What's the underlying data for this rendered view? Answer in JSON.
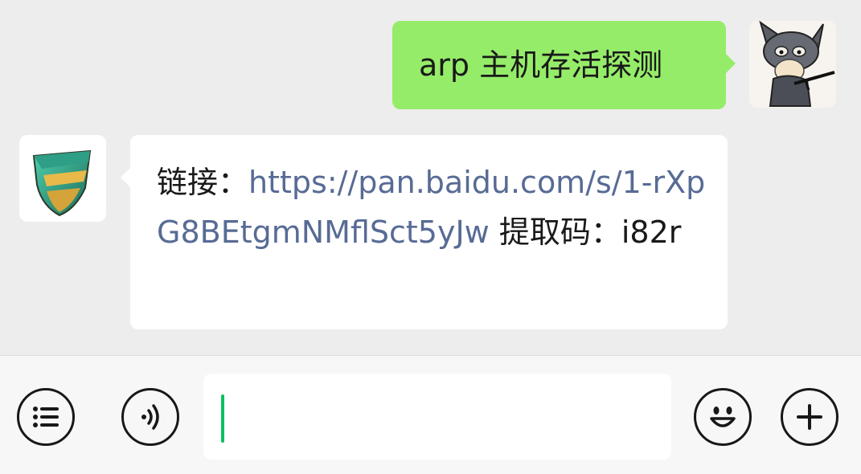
{
  "chat": {
    "messages": [
      {
        "direction": "outgoing",
        "avatar_icon": "cat-hood-avatar-icon",
        "text": "arp 主机存活探测"
      },
      {
        "direction": "incoming",
        "avatar_icon": "shield-logo-icon",
        "prefix": "链接：",
        "link": "https://pan.baidu.com/s/1-rXpG8BEtgmNMflSct5yJw",
        "suffix": " 提取码：i82r"
      }
    ]
  },
  "input_bar": {
    "value": "",
    "icons": {
      "menu": "list-menu-icon",
      "voice": "voice-icon",
      "emoji": "emoji-icon",
      "more": "plus-icon"
    }
  },
  "colors": {
    "outgoing_bubble": "#95ec69",
    "incoming_bubble": "#ffffff",
    "link": "#576b95",
    "background": "#ededed",
    "caret": "#07c160"
  }
}
